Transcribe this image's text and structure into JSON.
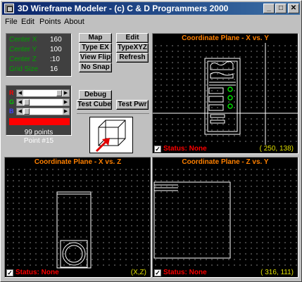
{
  "window": {
    "title": "3D Wireframe Modeler - (c) C & D Programmers 2000",
    "minimize": "_",
    "maximize": "□",
    "close": "✕"
  },
  "menu": {
    "file": "File",
    "edit": "Edit",
    "points": "Points",
    "about": "About"
  },
  "info": {
    "rows": [
      {
        "label": "Center X",
        "value": "160"
      },
      {
        "label": "Center Y",
        "value": "100"
      },
      {
        "label": "Center Z",
        "value": ":10"
      },
      {
        "label": "Grid Size",
        "value": "16"
      }
    ]
  },
  "buttons": {
    "map": "Map",
    "edit": "Edit",
    "type_ex": "Type EX",
    "type_xyz": "TypeXYZ",
    "view_flip": "View Flip",
    "refresh": "Refresh",
    "no_snap": "No Snap",
    "debug": "Debug",
    "test_cube": "Test Cube",
    "test_pwr": "Test Pwr"
  },
  "color": {
    "labels": [
      "R",
      "G",
      "B"
    ],
    "swatch": "#ff0000",
    "points_count": "99 points",
    "point_selected": "Point #15"
  },
  "panels": {
    "xy": {
      "title": "Coordinate Plane - X vs. Y",
      "status": "Status: None",
      "coords": "( 250,  138)"
    },
    "xz": {
      "title": "Coordinate Plane - X vs. Z",
      "status": "Status: None",
      "coords": "(X,Z)"
    },
    "zy": {
      "title": "Coordinate Plane - Z vs. Y",
      "status": "Status: None",
      "coords": "( 316,  111)"
    }
  },
  "colors": {
    "title_accent": "#ff8000",
    "status_text": "#ff0000",
    "coord_text": "#e0e000",
    "info_label": "#00a000"
  }
}
